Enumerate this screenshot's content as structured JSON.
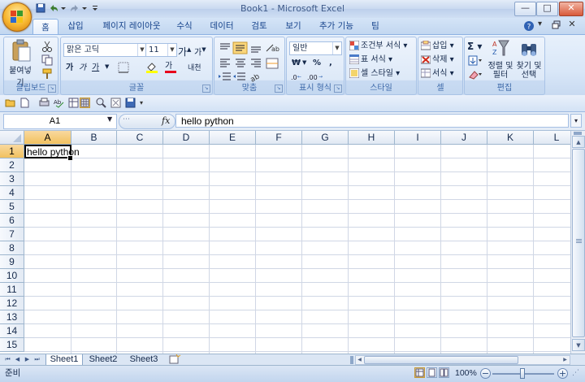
{
  "window": {
    "title": "Book1 - Microsoft Excel",
    "minimize": "—",
    "maximize": "□",
    "close": "✕"
  },
  "ribbon_tabs": [
    {
      "label": "홈",
      "active": true
    },
    {
      "label": "삽입"
    },
    {
      "label": "페이지 레이아웃"
    },
    {
      "label": "수식"
    },
    {
      "label": "데이터"
    },
    {
      "label": "검토"
    },
    {
      "label": "보기"
    },
    {
      "label": "추가 기능"
    },
    {
      "label": "팀"
    }
  ],
  "ribbon": {
    "clipboard": {
      "label": "클립보드",
      "paste": "붙여넣기"
    },
    "font": {
      "label": "글꼴",
      "font_name": "맑은 고딕",
      "font_size": "11",
      "bold": "가",
      "italic": "가",
      "underline": "가",
      "grow": "가",
      "shrink": "가",
      "color_char": "가",
      "phonetic": "내천"
    },
    "alignment": {
      "label": "맞춤"
    },
    "number": {
      "label": "표시 형식",
      "format": "일반",
      "currency": "₩",
      "percent": "%",
      "comma": ","
    },
    "styles": {
      "label": "스타일",
      "conditional": "조건부 서식",
      "table_format": "표 서식",
      "cell_styles": "셀 스타일"
    },
    "cells": {
      "label": "셀",
      "insert": "삽입",
      "delete": "삭제",
      "format": "서식"
    },
    "editing": {
      "label": "편집",
      "sort": "정렬 및\n필터",
      "find": "찾기 및\n선택"
    }
  },
  "formula_bar": {
    "name_box": "A1",
    "fx": "fx",
    "value": "hello python"
  },
  "grid": {
    "columns": [
      "A",
      "B",
      "C",
      "D",
      "E",
      "F",
      "G",
      "H",
      "I",
      "J",
      "K",
      "L"
    ],
    "rows": [
      "1",
      "2",
      "3",
      "4",
      "5",
      "6",
      "7",
      "8",
      "9",
      "10",
      "11",
      "12",
      "13",
      "14",
      "15"
    ],
    "selected_cell": "A1",
    "cells": {
      "A1": "hello python"
    }
  },
  "sheets": [
    {
      "name": "Sheet1",
      "active": true
    },
    {
      "name": "Sheet2"
    },
    {
      "name": "Sheet3"
    }
  ],
  "status": {
    "ready": "준비",
    "zoom": "100%",
    "zoom_minus": "−",
    "zoom_plus": "+"
  },
  "colors": {
    "accent": "#15428b",
    "ribbon_bg": "#dbe8f8",
    "selected_header": "#f5c96a"
  }
}
